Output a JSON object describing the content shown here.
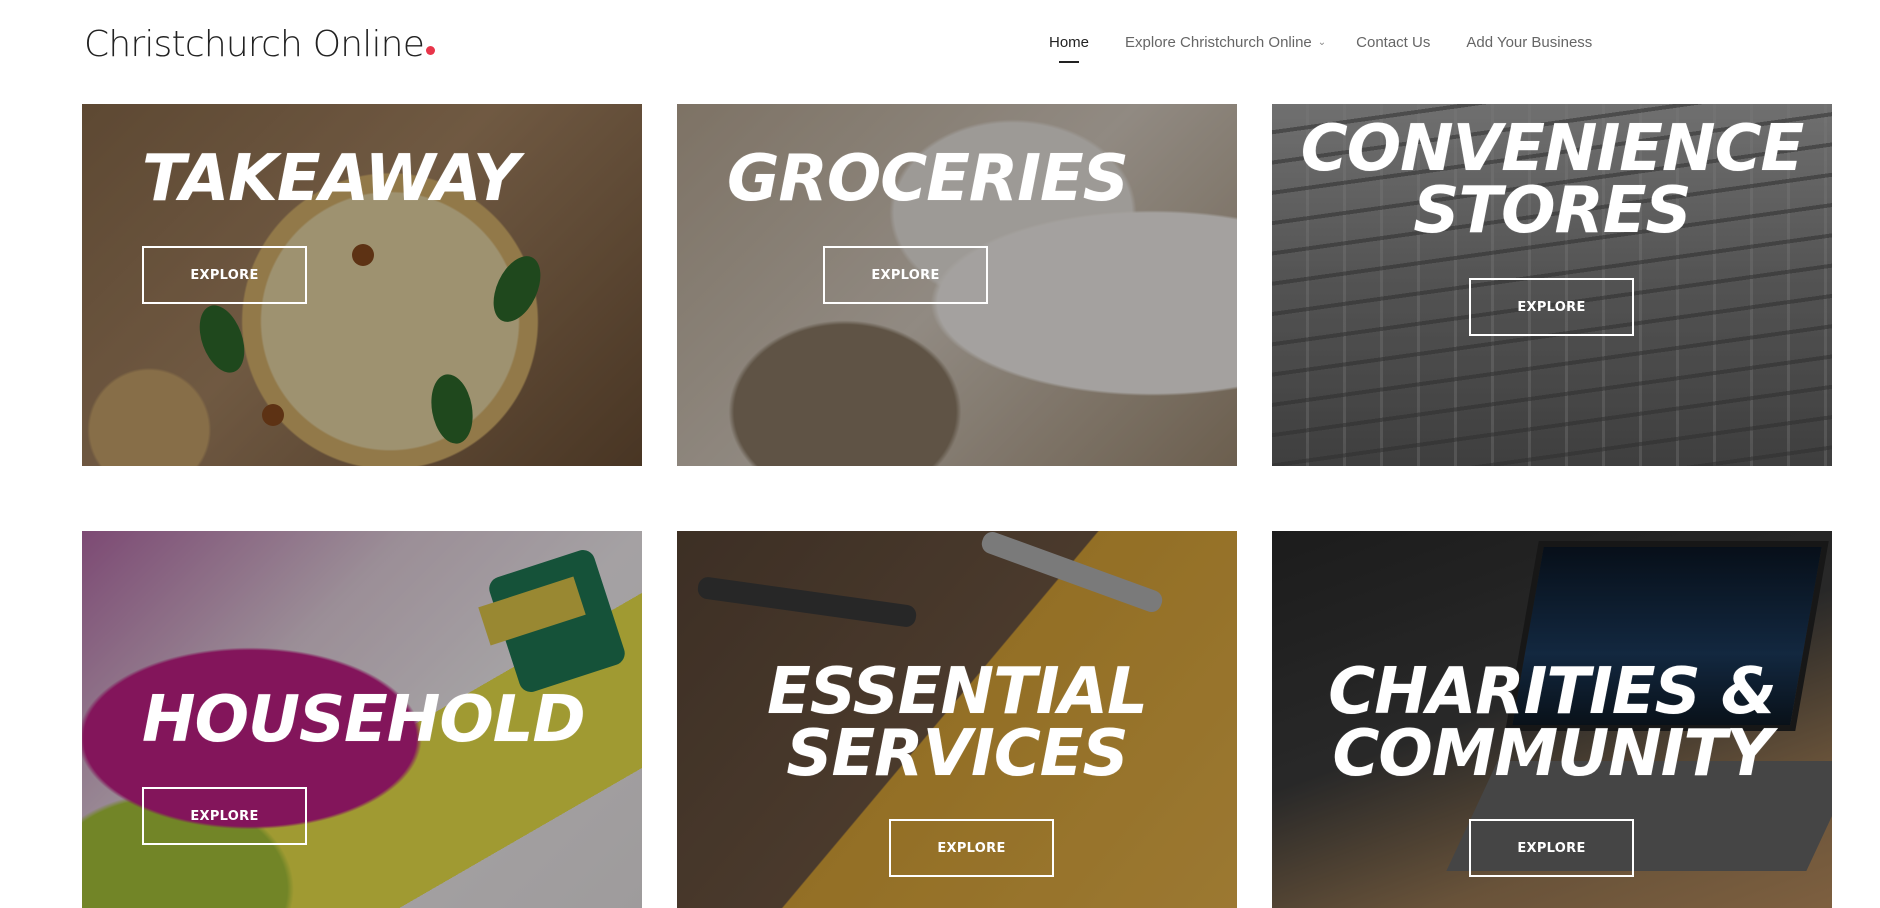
{
  "header": {
    "logo_text": "Christchurch Online",
    "nav": [
      {
        "label": "Home",
        "active": true
      },
      {
        "label": "Explore Christchurch Online",
        "has_dropdown": true
      },
      {
        "label": "Contact Us"
      },
      {
        "label": "Add Your Business"
      }
    ]
  },
  "tiles": [
    {
      "title": "TAKEAWAY",
      "button": "EXPLORE"
    },
    {
      "title": "GROCERIES",
      "button": "EXPLORE"
    },
    {
      "title_lines": [
        "CONVENIENCE",
        "STORES"
      ],
      "button": "EXPLORE"
    },
    {
      "title": "HOUSEHOLD",
      "button": "EXPLORE"
    },
    {
      "title_lines": [
        "ESSENTIAL",
        "SERVICES"
      ],
      "button": "EXPLORE"
    },
    {
      "title_lines": [
        "CHARITIES &",
        "COMMUNITY"
      ],
      "button": "EXPLORE"
    }
  ],
  "colors": {
    "accent_dot": "#e8354a",
    "overlay": "rgba(0,0,0,0.32)"
  },
  "icons": {
    "nav_dropdown": "chevron-down-icon"
  }
}
